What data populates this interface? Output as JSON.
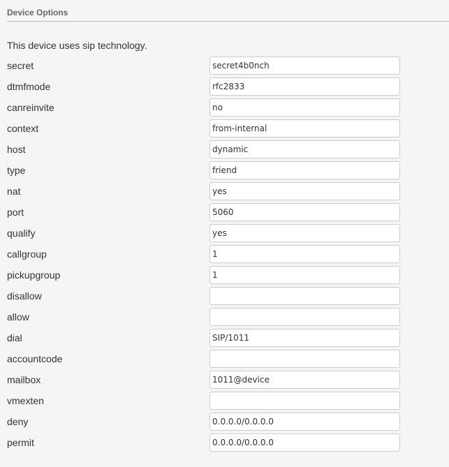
{
  "section": {
    "title": "Device Options"
  },
  "intro_text": "This device uses sip technology.",
  "fields": [
    {
      "label": "secret",
      "value": "secret4b0nch"
    },
    {
      "label": "dtmfmode",
      "value": "rfc2833"
    },
    {
      "label": "canreinvite",
      "value": "no"
    },
    {
      "label": "context",
      "value": "from-internal"
    },
    {
      "label": "host",
      "value": "dynamic"
    },
    {
      "label": "type",
      "value": "friend"
    },
    {
      "label": "nat",
      "value": "yes"
    },
    {
      "label": "port",
      "value": "5060"
    },
    {
      "label": "qualify",
      "value": "yes"
    },
    {
      "label": "callgroup",
      "value": "1"
    },
    {
      "label": "pickupgroup",
      "value": "1"
    },
    {
      "label": "disallow",
      "value": ""
    },
    {
      "label": "allow",
      "value": ""
    },
    {
      "label": "dial",
      "value": "SIP/1011"
    },
    {
      "label": "accountcode",
      "value": ""
    },
    {
      "label": "mailbox",
      "value": "1011@device"
    },
    {
      "label": "vmexten",
      "value": ""
    },
    {
      "label": "deny",
      "value": "0.0.0.0/0.0.0.0"
    },
    {
      "label": "permit",
      "value": "0.0.0.0/0.0.0.0"
    }
  ]
}
